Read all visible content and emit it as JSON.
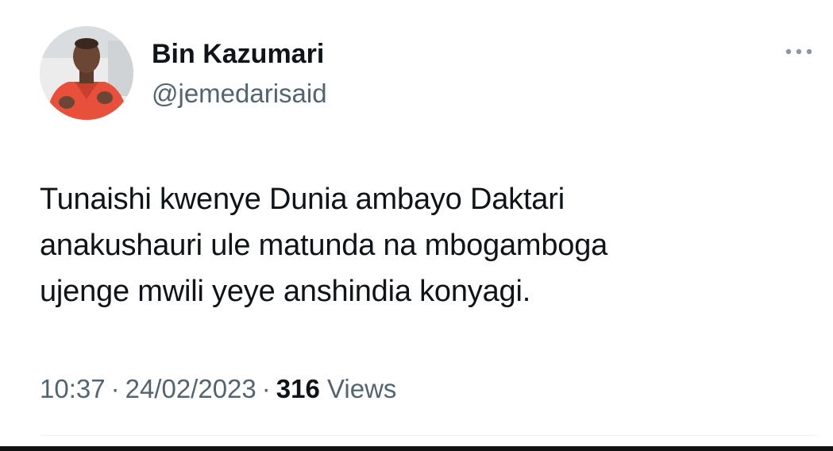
{
  "author": {
    "display_name": "Bin Kazumari",
    "handle": "@jemedarisaid"
  },
  "tweet": {
    "lines": [
      "Tunaishi kwenye Dunia ambayo Daktari",
      "anakushauri ule matunda na mbogamboga",
      "ujenge mwili yeye anshindia konyagi."
    ]
  },
  "meta": {
    "time": "10:37",
    "separator": "·",
    "date": "24/02/2023",
    "views_count": "316",
    "views_label": "Views"
  },
  "icons": {
    "more": "more-horizontal-icon",
    "avatar": "profile-photo"
  },
  "colors": {
    "text_primary": "#0f1419",
    "text_secondary": "#536471",
    "divider": "#eff3f4",
    "avatar_shirt": "#e8503c"
  }
}
